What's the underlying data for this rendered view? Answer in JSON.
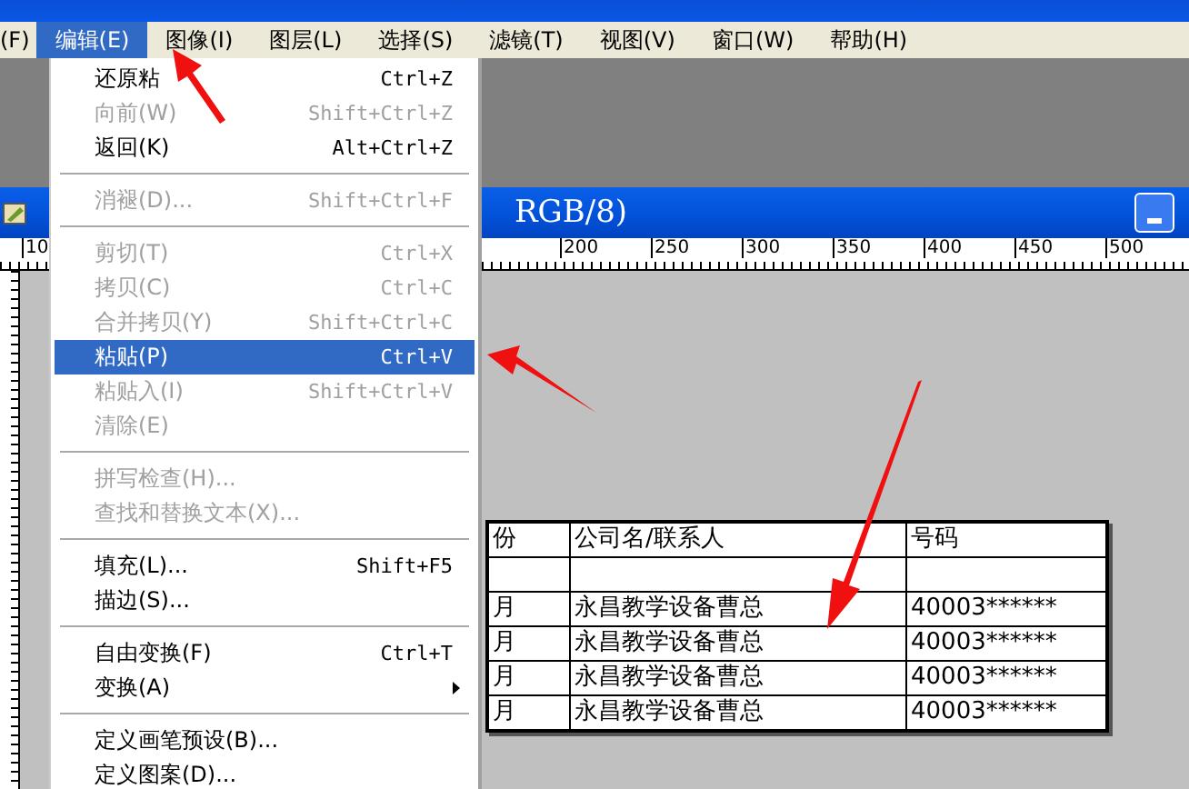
{
  "menubar": [
    {
      "label": "(F)",
      "selected": false
    },
    {
      "label": "编辑(E)",
      "selected": true
    },
    {
      "label": "图像(I)",
      "selected": false
    },
    {
      "label": "图层(L)",
      "selected": false
    },
    {
      "label": "选择(S)",
      "selected": false
    },
    {
      "label": "滤镜(T)",
      "selected": false
    },
    {
      "label": "视图(V)",
      "selected": false
    },
    {
      "label": "窗口(W)",
      "selected": false
    },
    {
      "label": "帮助(H)",
      "selected": false
    }
  ],
  "document": {
    "title_end": "RGB/8)",
    "ruler_labels": [
      "10",
      "200",
      "250",
      "300",
      "350",
      "400",
      "450",
      "500"
    ],
    "table": {
      "header": [
        "份",
        "公司名/联系人",
        "号码"
      ],
      "rows": [
        [
          "",
          "",
          ""
        ],
        [
          "月",
          "永昌教学设备曹总",
          "40003******"
        ],
        [
          "月",
          "永昌教学设备曹总",
          "40003******"
        ],
        [
          "月",
          "永昌教学设备曹总",
          "40003******"
        ],
        [
          "月",
          "永昌教学设备曹总",
          "40003******"
        ]
      ]
    }
  },
  "edit_menu": [
    {
      "kind": "item",
      "label": "还原粘",
      "shortcut": "Ctrl+Z",
      "disabled": false,
      "selected": false,
      "has_submenu": false
    },
    {
      "kind": "item",
      "label": "向前(W)",
      "shortcut": "Shift+Ctrl+Z",
      "disabled": true,
      "selected": false,
      "has_submenu": false
    },
    {
      "kind": "item",
      "label": "返回(K)",
      "shortcut": "Alt+Ctrl+Z",
      "disabled": false,
      "selected": false,
      "has_submenu": false
    },
    {
      "kind": "separator"
    },
    {
      "kind": "item",
      "label": "消褪(D)...",
      "shortcut": "Shift+Ctrl+F",
      "disabled": true,
      "selected": false,
      "has_submenu": false
    },
    {
      "kind": "separator"
    },
    {
      "kind": "item",
      "label": "剪切(T)",
      "shortcut": "Ctrl+X",
      "disabled": true,
      "selected": false,
      "has_submenu": false
    },
    {
      "kind": "item",
      "label": "拷贝(C)",
      "shortcut": "Ctrl+C",
      "disabled": true,
      "selected": false,
      "has_submenu": false
    },
    {
      "kind": "item",
      "label": "合并拷贝(Y)",
      "shortcut": "Shift+Ctrl+C",
      "disabled": true,
      "selected": false,
      "has_submenu": false
    },
    {
      "kind": "item",
      "label": "粘贴(P)",
      "shortcut": "Ctrl+V",
      "disabled": false,
      "selected": true,
      "has_submenu": false
    },
    {
      "kind": "item",
      "label": "粘贴入(I)",
      "shortcut": "Shift+Ctrl+V",
      "disabled": true,
      "selected": false,
      "has_submenu": false
    },
    {
      "kind": "item",
      "label": "清除(E)",
      "disabled": true,
      "selected": false,
      "has_submenu": false
    },
    {
      "kind": "separator"
    },
    {
      "kind": "item",
      "label": "拼写检查(H)...",
      "disabled": true,
      "selected": false,
      "has_submenu": false
    },
    {
      "kind": "item",
      "label": "查找和替换文本(X)...",
      "disabled": true,
      "selected": false,
      "has_submenu": false
    },
    {
      "kind": "separator"
    },
    {
      "kind": "item",
      "label": "填充(L)...",
      "shortcut": "Shift+F5",
      "disabled": false,
      "selected": false,
      "has_submenu": false
    },
    {
      "kind": "item",
      "label": "描边(S)...",
      "disabled": false,
      "selected": false,
      "has_submenu": false
    },
    {
      "kind": "separator"
    },
    {
      "kind": "item",
      "label": "自由变换(F)",
      "shortcut": "Ctrl+T",
      "disabled": false,
      "selected": false,
      "has_submenu": false
    },
    {
      "kind": "item",
      "label": "变换(A)",
      "disabled": false,
      "selected": false,
      "has_submenu": true
    },
    {
      "kind": "separator"
    },
    {
      "kind": "item",
      "label": "定义画笔预设(B)...",
      "disabled": false,
      "selected": false,
      "has_submenu": false
    },
    {
      "kind": "item",
      "label": "定义图案(D)...",
      "disabled": false,
      "selected": false,
      "has_submenu": false
    }
  ]
}
